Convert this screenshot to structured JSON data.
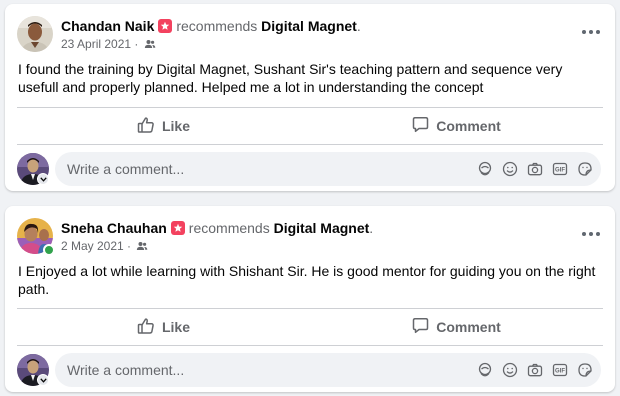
{
  "posts": [
    {
      "author": "Chandan Naik",
      "verb": "recommends",
      "page": "Digital Magnet",
      "date": "23 April 2021 ·",
      "text": "I found the training by Digital Magnet, Sushant Sir's teaching pattern and sequence very usefull and properly planned. Helped me a lot in understanding the concept",
      "online": false
    },
    {
      "author": "Sneha Chauhan",
      "verb": "recommends",
      "page": "Digital Magnet",
      "date": "2 May 2021 ·",
      "text": "I Enjoyed a lot while learning with Shishant Sir. He is good mentor for guiding you on the right path.",
      "online": true
    }
  ],
  "actions": {
    "like": "Like",
    "comment": "Comment"
  },
  "composer": {
    "placeholder": "Write a comment..."
  },
  "icons": [
    "recommend-star-icon",
    "friends-audience-icon",
    "more-options-icon",
    "like-thumb-icon",
    "comment-bubble-icon",
    "avatar-sticker-icon",
    "emoji-icon",
    "camera-icon",
    "gif-icon",
    "sticker-icon"
  ],
  "colors": {
    "recommend_badge": "#f3425f",
    "online": "#31a24c",
    "muted": "#65676b"
  }
}
